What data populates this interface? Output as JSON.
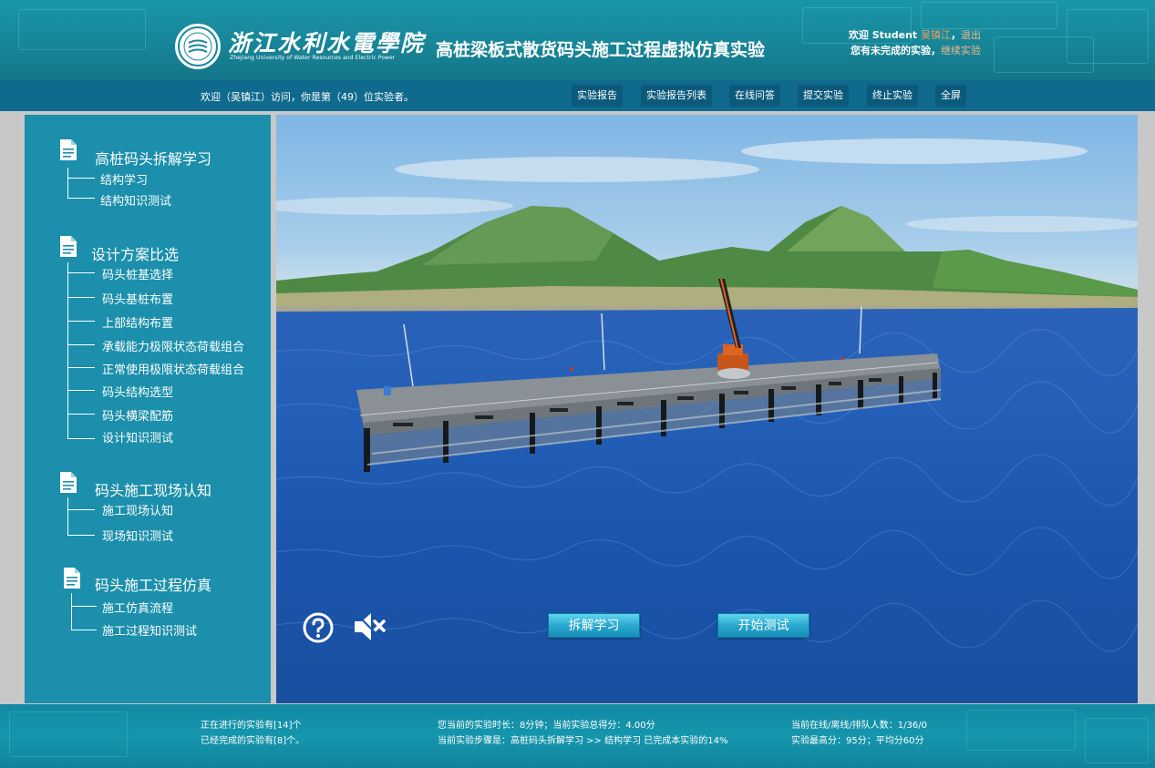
{
  "header": {
    "school_cn": "浙江水利水電學院",
    "school_en": "Zhejiang University of Water Resources and Electric Power",
    "title": "高桩梁板式散货码头施工过程虚拟仿真实验",
    "welcome_prefix": "欢迎 Student",
    "user_name": "吴镇江",
    "comma": "，",
    "logout": "退出",
    "unfinished_text": "您有未完成的实验，",
    "continue_link": "继续实验"
  },
  "navbar": {
    "visit_text": "欢迎（吴镇江）访问，你是第（49）位实验者。",
    "buttons": [
      "实验报告",
      "实验报告列表",
      "在线问答",
      "提交实验",
      "终止实验",
      "全屏"
    ]
  },
  "sidebar": {
    "sections": [
      {
        "title": "高桩码头拆解学习",
        "items": [
          "结构学习",
          "结构知识测试"
        ]
      },
      {
        "title": "设计方案比选",
        "items": [
          "码头桩基选择",
          "码头基桩布置",
          "上部结构布置",
          "承载能力极限状态荷载组合",
          "正常使用极限状态荷载组合",
          "码头结构选型",
          "码头横梁配筋",
          "设计知识测试"
        ]
      },
      {
        "title": "码头施工现场认知",
        "items": [
          "施工现场认知",
          "现场知识测试"
        ]
      },
      {
        "title": "码头施工过程仿真",
        "items": [
          "施工仿真流程",
          "施工过程知识测试"
        ]
      }
    ]
  },
  "scene": {
    "disassemble_button": "拆解学习",
    "start_test_button": "开始测试"
  },
  "footer": {
    "running_count": "正在进行的实验有[14]个",
    "finished_count": "已经完成的实验有[8]个。",
    "duration": "您当前的实验时长：8分钟；当前实验总得分：4.00分",
    "step": "当前实验步骤是：高桩码头拆解学习 >> 结构学习 已完成本实验的14%",
    "online": "当前在线/离线/排队人数：1/36/0",
    "scores": "实验最高分：95分；平均分60分"
  },
  "colors": {
    "header_bg": "#1a96a8",
    "navbar_bg": "#0f6a8e",
    "sidebar_bg": "#1b8fab",
    "accent_orange": "#f0a060",
    "scene_button": "#2aa8cf"
  }
}
